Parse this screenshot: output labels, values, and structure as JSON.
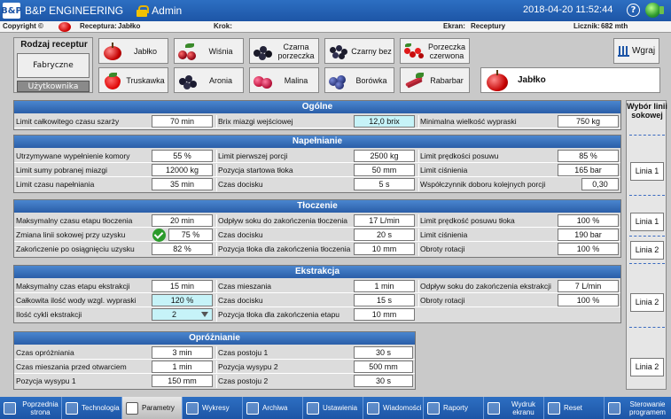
{
  "topbar": {
    "logo": "B&P",
    "brand": "B&P ENGINEERING",
    "user": "Admin",
    "datetime": "2018-04-20 11:52:44"
  },
  "statusbar": {
    "copyright": "Copyright ©",
    "recipe_label": "Receptura:",
    "recipe_value": "Jabłko",
    "step_label": "Krok:",
    "screen_label": "Ekran:",
    "screen_value": "Receptury",
    "counter_label": "Licznik:",
    "counter_value": "682 mth"
  },
  "recipe_type": {
    "title": "Rodzaj receptur",
    "factory": "Fabryczne",
    "user": "Użytkownika"
  },
  "fruits": [
    {
      "label": "Jabłko"
    },
    {
      "label": "Wiśnia"
    },
    {
      "label": "Czarna porzeczka"
    },
    {
      "label": "Czarny bez"
    },
    {
      "label": "Porzeczka czerwona"
    },
    {
      "label": "Truskawka"
    },
    {
      "label": "Aronia"
    },
    {
      "label": "Malina"
    },
    {
      "label": "Borówka"
    },
    {
      "label": "Rabarbar"
    }
  ],
  "load_button": "Wgraj",
  "selected_recipe": "Jabłko",
  "sections": {
    "ogolne": {
      "title": "Ogólne",
      "r1": {
        "l1": "Limit całkowitego czasu szarży",
        "v1": "70 min",
        "l2": "Brix miazgi wejściowej",
        "v2": "12,0 brix",
        "l3": "Minimalna wielkość wypraski",
        "v3": "750 kg"
      }
    },
    "napelnianie": {
      "title": "Napełnianie",
      "r1": {
        "l1": "Utrzymywane wypełnienie komory",
        "v1": "55 %",
        "l2": "Limit pierwszej porcji",
        "v2": "2500 kg",
        "l3": "Limit prędkości posuwu",
        "v3": "85 %"
      },
      "r2": {
        "l1": "Limit sumy pobranej miazgi",
        "v1": "12000 kg",
        "l2": "Pozycja startowa tłoka",
        "v2": "50 mm",
        "l3": "Limit ciśnienia",
        "v3": "165 bar"
      },
      "r3": {
        "l1": "Limit czasu napełniania",
        "v1": "35 min",
        "l2": "Czas docisku",
        "v2": "5 s",
        "l3": "Współczynnik doboru kolejnych porcji",
        "v3": "0,30"
      }
    },
    "tloczenie": {
      "title": "Tłoczenie",
      "r1": {
        "l1": "Maksymalny czasu etapu tłoczenia",
        "v1": "20 min",
        "l2": "Odpływ soku do zakończenia tłoczenia",
        "v2": "17 L/min",
        "l3": "Limit prędkość posuwu tłoka",
        "v3": "100 %"
      },
      "r2": {
        "l1": "Zmiana linii sokowej przy uzysku",
        "v1": "75 %",
        "l2": "Czas docisku",
        "v2": "20 s",
        "l3": "Limit ciśnienia",
        "v3": "190 bar"
      },
      "r3": {
        "l1": "Zakończenie po osiągnięciu uzysku",
        "v1": "82 %",
        "l2": "Pozycja tłoka dla zakończenia tłoczenia",
        "v2": "10 mm",
        "l3": "Obroty rotacji",
        "v3": "100 %"
      }
    },
    "ekstrakcja": {
      "title": "Ekstrakcja",
      "r1": {
        "l1": "Maksymalny czas etapu ekstrakcji",
        "v1": "15 min",
        "l2": "Czas mieszania",
        "v2": "1 min",
        "l3": "Odpływ soku do zakończenia ekstrakcji",
        "v3": "7 L/min"
      },
      "r2": {
        "l1": "Całkowita ilość wody wzgl. wypraski",
        "v1": "120 %",
        "l2": "Czas docisku",
        "v2": "15 s",
        "l3": "Obroty rotacji",
        "v3": "100 %"
      },
      "r3": {
        "l1": "Ilość cykli ekstrakcji",
        "v1": "2",
        "l2": "Pozycja tłoka dla zakończenia etapu",
        "v2": "10 mm"
      }
    },
    "oproznianie": {
      "title": "Opróżnianie",
      "r1": {
        "l1": "Czas opróżniania",
        "v1": "3 min",
        "l2": "Czas postoju 1",
        "v2": "30 s"
      },
      "r2": {
        "l1": "Czas mieszania przed otwarciem",
        "v1": "1 min",
        "l2": "Pozycja wysypu 2",
        "v2": "500 mm"
      },
      "r3": {
        "l1": "Pozycja wysypu 1",
        "v1": "150 mm",
        "l2": "Czas postoju 2",
        "v2": "30 s"
      }
    }
  },
  "line_select": {
    "title": "Wybór linii sokowej",
    "napelnianie": "Linia 1",
    "tloczenie_1": "Linia 1",
    "tloczenie_2": "Linia 2",
    "ekstrakcja": "Linia 2",
    "oproznianie": "Linia 2"
  },
  "nav": [
    {
      "label": "Poprzednia strona"
    },
    {
      "label": "Technologia"
    },
    {
      "label": "Parametry"
    },
    {
      "label": "Wykresy"
    },
    {
      "label": "Archiwa"
    },
    {
      "label": "Ustawienia"
    },
    {
      "label": "Wiadomości"
    },
    {
      "label": "Raporty"
    },
    {
      "label": "Wydruk ekranu"
    },
    {
      "label": "Reset"
    },
    {
      "label": "Sterowanie programem"
    }
  ]
}
